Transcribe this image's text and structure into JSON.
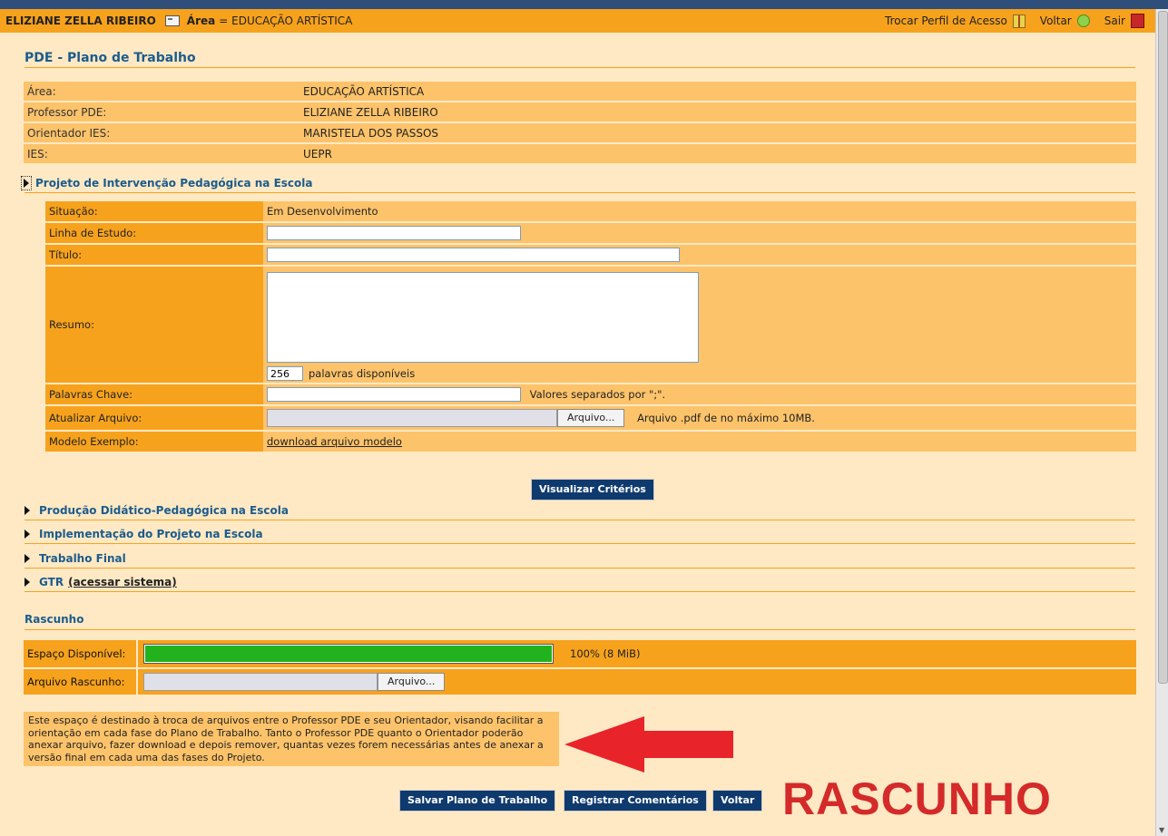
{
  "header": {
    "user_name": "ELIZIANE ZELLA RIBEIRO",
    "area_label": "Área",
    "area_value": "= EDUCAÇÃO ARTÍSTICA",
    "change_profile": "Trocar Perfil de Acesso",
    "back": "Voltar",
    "exit": "Sair",
    "icons": [
      "id-card-icon",
      "gift-icon",
      "back-circle-icon",
      "exit-door-icon"
    ]
  },
  "page_title": "PDE - Plano de Trabalho",
  "info": [
    {
      "label": "Área:",
      "value": "EDUCAÇÃO ARTÍSTICA"
    },
    {
      "label": "Professor PDE:",
      "value": "ELIZIANE ZELLA RIBEIRO"
    },
    {
      "label": "Orientador IES:",
      "value": "MARISTELA DOS PASSOS"
    },
    {
      "label": "IES:",
      "value": "UEPR"
    }
  ],
  "project": {
    "section_title": "Projeto de Intervenção Pedagógica na Escola",
    "situacao_label": "Situação:",
    "situacao_value": "Em Desenvolvimento",
    "linha_label": "Linha de Estudo:",
    "linha_value": "",
    "titulo_label": "Título:",
    "titulo_value": "",
    "resumo_label": "Resumo:",
    "resumo_value": "",
    "words_count": "256",
    "words_text": "palavras disponíveis",
    "palavras_label": "Palavras Chave:",
    "palavras_value": "",
    "palavras_hint": "Valores separados por \";\".",
    "arquivo_label": "Atualizar Arquivo:",
    "arquivo_button": "Arquivo...",
    "arquivo_hint": "Arquivo .pdf de no máximo 10MB.",
    "modelo_label": "Modelo Exemplo:",
    "modelo_link": "download arquivo modelo",
    "criteria_button": "Visualizar Critérios"
  },
  "sections": [
    {
      "title": "Produção Didático-Pedagógica na Escola"
    },
    {
      "title": "Implementação do Projeto na Escola"
    },
    {
      "title": "Trabalho Final"
    },
    {
      "title": "GTR",
      "link": "(acessar sistema)"
    }
  ],
  "rascunho": {
    "title": "Rascunho",
    "espaco_label": "Espaço Disponível:",
    "espaco_percent": 100,
    "espaco_text": "100% (8 MiB)",
    "arquivo_label": "Arquivo Rascunho:",
    "arquivo_button": "Arquivo...",
    "note": "Este espaço é destinado à troca de arquivos entre o Professor PDE e seu Orientador, visando facilitar a orientação em cada fase do Plano de Trabalho. Tanto o Professor PDE quanto o Orientador poderão anexar arquivo, fazer download e depois remover, quantas vezes forem necessárias antes de anexar a versão final em cada uma das fases do Projeto."
  },
  "actions": {
    "save": "Salvar Plano de Trabalho",
    "comments": "Registrar Comentários",
    "back": "Voltar"
  },
  "annotation": {
    "text": "RASCUNHO",
    "arrow_color": "#e8232a",
    "text_color": "#d42a2a"
  },
  "colors": {
    "header_bg": "#f7a21c",
    "label_bg": "#f7a21c",
    "value_bg": "#fdc36a",
    "page_bg": "#ffe9c4",
    "title_blue": "#1c5c8c",
    "button_blue": "#0f3a6e",
    "progress_green": "#22b21e"
  }
}
